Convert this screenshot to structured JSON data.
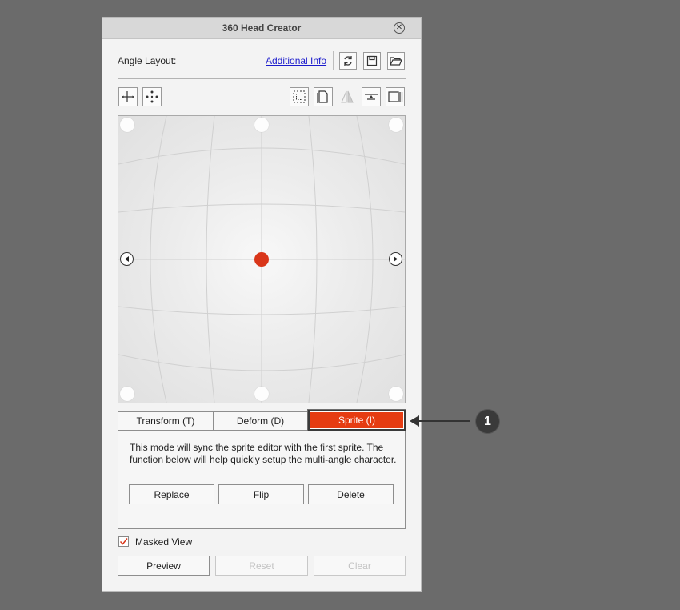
{
  "window": {
    "title": "360 Head Creator"
  },
  "header": {
    "angle_layout_label": "Angle Layout:",
    "additional_info_link": "Additional Info"
  },
  "tabs": [
    {
      "label": "Transform (T)",
      "active": false
    },
    {
      "label": "Deform (D)",
      "active": false
    },
    {
      "label": "Sprite (I)",
      "active": true
    }
  ],
  "sprite_panel": {
    "description": "This mode will sync the sprite editor with the first sprite. The function below will help quickly setup the multi-angle character.",
    "buttons": [
      "Replace",
      "Flip",
      "Delete"
    ]
  },
  "masked_view": {
    "label": "Masked View",
    "checked": true
  },
  "footer_buttons": [
    {
      "label": "Preview",
      "enabled": true
    },
    {
      "label": "Reset",
      "enabled": false
    },
    {
      "label": "Clear",
      "enabled": false
    }
  ],
  "callout": {
    "number": "1"
  },
  "colors": {
    "accent": "#e63c12",
    "background": "#6b6b6b",
    "panel": "#f3f3f3"
  },
  "icons": [
    "close-icon",
    "sync-icon",
    "save-icon",
    "open-folder-icon",
    "move-axis-icon",
    "move-points-icon",
    "select-region-icon",
    "duplicate-icon",
    "mirror-icon",
    "align-center-icon",
    "panel-layout-icon",
    "left-arrow-icon",
    "right-arrow-icon",
    "checkmark-icon"
  ]
}
